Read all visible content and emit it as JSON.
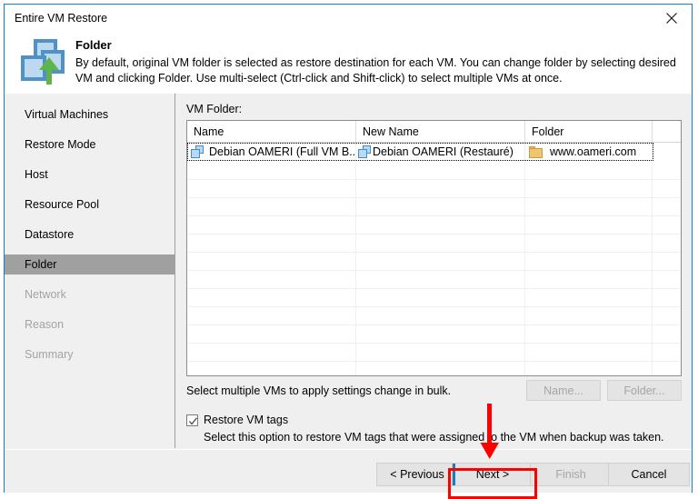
{
  "window": {
    "title": "Entire VM Restore",
    "close_icon": "close-icon"
  },
  "header": {
    "icon": "vm-restore-icon",
    "title": "Folder",
    "description": "By default, original VM folder is selected as restore destination for each VM. You can change folder by selecting desired VM and clicking Folder. Use multi-select (Ctrl-click and Shift-click) to select multiple VMs at once."
  },
  "sidebar": {
    "items": [
      {
        "label": "Virtual Machines",
        "state": "normal"
      },
      {
        "label": "Restore Mode",
        "state": "normal"
      },
      {
        "label": "Host",
        "state": "normal"
      },
      {
        "label": "Resource Pool",
        "state": "normal"
      },
      {
        "label": "Datastore",
        "state": "normal"
      },
      {
        "label": "Folder",
        "state": "selected"
      },
      {
        "label": "Network",
        "state": "disabled"
      },
      {
        "label": "Reason",
        "state": "disabled"
      },
      {
        "label": "Summary",
        "state": "disabled"
      }
    ]
  },
  "main": {
    "section_label": "VM Folder:",
    "table": {
      "columns": [
        "Name",
        "New Name",
        "Folder",
        ""
      ],
      "rows": [
        {
          "name": "Debian OAMERI (Full VM B...",
          "name_icon": "vm-icon",
          "new_name": "Debian OAMERI (Restauré)",
          "new_name_icon": "vm-icon",
          "folder": "www.oameri.com",
          "folder_icon": "folder-icon",
          "selected": true
        }
      ],
      "empty_row_count": 13
    },
    "bulk_hint": "Select multiple VMs to apply settings change in bulk.",
    "buttons": {
      "name": "Name...",
      "folder": "Folder..."
    },
    "restore_tags": {
      "label": "Restore VM tags",
      "checked": true,
      "description": "Select this option to restore VM tags that were assigned to the VM when backup was taken."
    }
  },
  "footer": {
    "previous": "< Previous",
    "next": "Next >",
    "finish": "Finish",
    "cancel": "Cancel"
  },
  "annotation": {
    "arrow_color": "#ff0000",
    "highlight_color": "#ff0000",
    "highlight_target": "Next >"
  },
  "colors": {
    "dialog_border": "#1a7dc4",
    "selected_nav": "#a0a0a0",
    "focus_accent": "#1a7dc4",
    "icon_blue": "#3f8ccc",
    "icon_green": "#5fb54a",
    "folder_gold": "#f0c572"
  }
}
